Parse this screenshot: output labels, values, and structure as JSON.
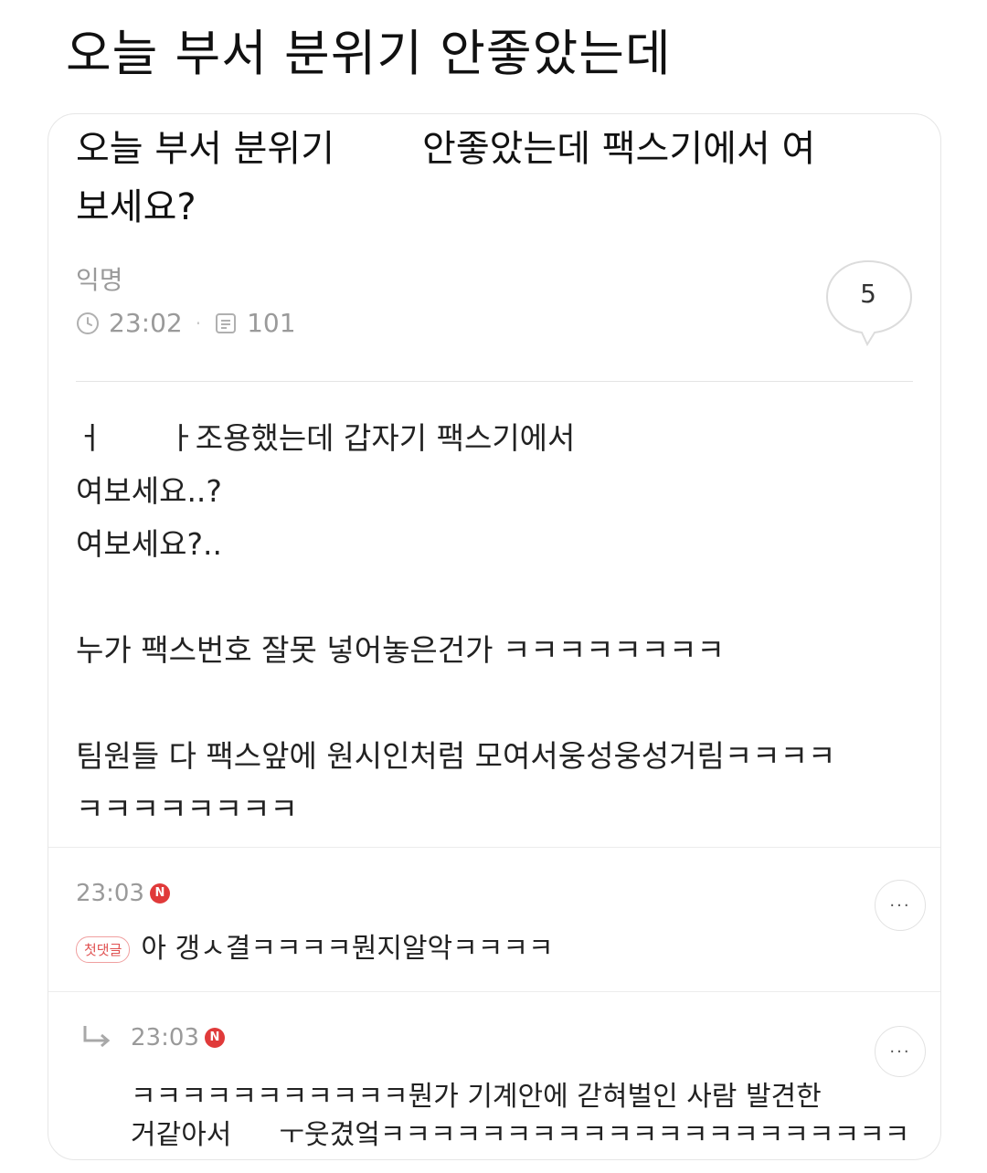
{
  "headline": "오늘 부서 분위기 안좋았는데",
  "post": {
    "title_part1": "오늘 부서 분위기",
    "title_part2": "안좋았는데 팩스기에서 여",
    "title_line2": "보세요?",
    "author": "익명",
    "time": "23:02",
    "views": "101",
    "comment_count": "5",
    "body": {
      "line1_start": "ㅓ",
      "line1_rest": "ㅏ조용했는데 갑자기 팩스기에서",
      "line2": "여보세요..?",
      "line3": "여보세요?..",
      "line4": "누가 팩스번호 잘못 넣어놓은건가 ㅋㅋㅋㅋㅋㅋㅋㅋ",
      "line5": "팀원들 다 팩스앞에 원시인처럼 모여서웅성웅성거림ㅋㅋㅋㅋ",
      "line6": "ㅋㅋㅋㅋㅋㅋㅋㅋ"
    }
  },
  "comments": [
    {
      "time": "23:03",
      "new_badge": "N",
      "first_label": "첫댓글",
      "text": "아 갱ㅅ결ㅋㅋㅋㅋ뭔지알악ㅋㅋㅋㅋ",
      "more": "···"
    },
    {
      "time": "23:03",
      "new_badge": "N",
      "text_line1": "ㅋㅋㅋㅋㅋㅋㅋㅋㅋㅋㅋ뭔가 기계안에 갇혀벌인 사람 발견한",
      "text_line2_start": "거같아서",
      "text_line2_rest": "ㅜ웃겼엌ㅋㅋㅋㅋㅋㅋㅋㅋㅋㅋㅋㅋㅋㅋㅋㅋㅋㅋㅋㅋㅋ",
      "more": "···"
    }
  ],
  "colors": {
    "text": "#111111",
    "muted": "#9a9a9a",
    "badge_red": "#e03a3a",
    "border": "#e6e6e6"
  }
}
